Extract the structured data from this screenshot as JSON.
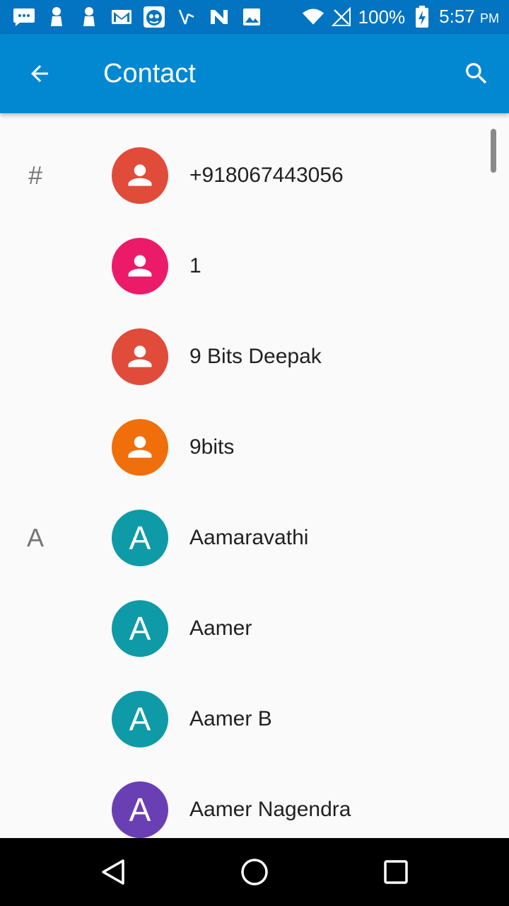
{
  "status_bar": {
    "icons": [
      "message-icon",
      "android-icon",
      "android-icon",
      "gmail-icon",
      "app-face-icon",
      "missed-call-icon",
      "n-app-icon",
      "gallery-icon",
      "wifi-icon",
      "no-signal-icon"
    ],
    "battery": "100%",
    "time": "5:57",
    "ampm": "PM"
  },
  "app_bar": {
    "title": "Contact",
    "back_icon": "arrow-back-icon",
    "search_icon": "search-icon",
    "color": "#0288d1"
  },
  "contacts": [
    {
      "section": "#",
      "name": "+918067443056",
      "avatar_type": "person",
      "avatar_letter": "",
      "color": "#e04b3a"
    },
    {
      "section": "",
      "name": "1",
      "avatar_type": "person",
      "avatar_letter": "",
      "color": "#ec1b6a"
    },
    {
      "section": "",
      "name": "9 Bits Deepak",
      "avatar_type": "person",
      "avatar_letter": "",
      "color": "#e04b3a"
    },
    {
      "section": "",
      "name": "9bits",
      "avatar_type": "person",
      "avatar_letter": "",
      "color": "#f06f0a"
    },
    {
      "section": "A",
      "name": "Aamaravathi",
      "avatar_type": "letter",
      "avatar_letter": "A",
      "color": "#0e9aa7"
    },
    {
      "section": "",
      "name": "Aamer",
      "avatar_type": "letter",
      "avatar_letter": "A",
      "color": "#0e9aa7"
    },
    {
      "section": "",
      "name": "Aamer B",
      "avatar_type": "letter",
      "avatar_letter": "A",
      "color": "#0e9aa7"
    },
    {
      "section": "",
      "name": "Aamer Nagendra",
      "avatar_type": "letter",
      "avatar_letter": "A",
      "color": "#6a3fb4"
    }
  ],
  "nav_bar": {
    "back": "back-triangle-icon",
    "home": "home-circle-icon",
    "recents": "recents-square-icon"
  }
}
